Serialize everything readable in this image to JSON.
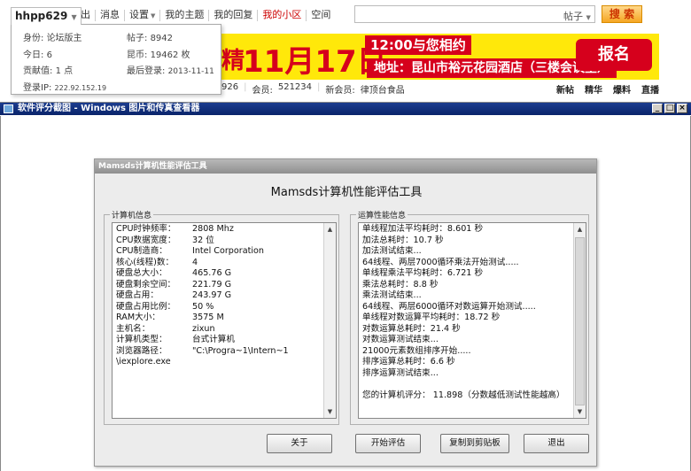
{
  "topbar": {
    "username": "hhpp629",
    "nav": [
      "退出",
      "消息",
      "设置",
      "我的主题",
      "我的回复",
      "我的小区",
      "空间"
    ],
    "search_scope": "帖子",
    "search_button": "搜 索"
  },
  "user_dropdown": {
    "identity_label": "身份:",
    "identity_value": "论坛版主",
    "posts_label": "帖子:",
    "posts_value": "8942",
    "today_label": "今日:",
    "today_value": "6",
    "coins_label": "昆币:",
    "coins_value": "19462 枚",
    "contrib_label": "贡献值:",
    "contrib_value": "1 点",
    "lastlogin_label": "最后登录:",
    "lastlogin_value": "2013-11-11",
    "ip_label": "登录IP:",
    "ip_value": "222.92.152.19"
  },
  "banner": {
    "pre": "精",
    "date": "11月17日",
    "time": "12:00与您相约",
    "address": "地址：昆山市裕元花园酒店（三楼会议室）",
    "register": "报名"
  },
  "stats": {
    "topics_tail": "926",
    "members_label": "会员:",
    "members_value": "521234",
    "newest_label": "新会员:",
    "newest_value": "律顶台食品"
  },
  "quick_links": [
    "新帖",
    "精华",
    "爆料",
    "直播"
  ],
  "viewer": {
    "title": "软件评分截图 - Windows 图片和传真查看器",
    "btn_min": "_",
    "btn_max": "□",
    "btn_close": "×"
  },
  "app": {
    "window_title": "Mamsds计算机性能评估工具",
    "heading": "Mamsds计算机性能评估工具",
    "computer_info_label": "计算机信息",
    "computer_info": [
      {
        "k": "CPU时钟频率：",
        "v": "2808 Mhz"
      },
      {
        "k": "CPU数据宽度：",
        "v": "32 位"
      },
      {
        "k": "CPU制造商：",
        "v": "Intel Corporation"
      },
      {
        "k": "核心(线程)数：",
        "v": "4"
      },
      {
        "k": "硬盘总大小：",
        "v": "465.76 G"
      },
      {
        "k": "硬盘剩余空间：",
        "v": "221.79 G"
      },
      {
        "k": "硬盘占用：",
        "v": "243.97 G"
      },
      {
        "k": "硬盘占用比例：",
        "v": "50 %"
      },
      {
        "k": "RAM大小：",
        "v": "3575 M"
      },
      {
        "k": "主机名：",
        "v": "zixun"
      },
      {
        "k": "计算机类型：",
        "v": "台式计算机"
      },
      {
        "k": "浏览器路径：",
        "v": "\"C:\\Progra~1\\Intern~1"
      },
      {
        "k": "\\iexplore.exe",
        "v": ""
      }
    ],
    "perf_info_label": "运算性能信息",
    "perf_info": [
      "单线程加法平均耗时：8.601 秒",
      "加法总耗时：10.7 秒",
      "加法测试结束...",
      "64线程、两层7000循环乘法开始测试.....",
      "单线程乘法平均耗时：6.721 秒",
      "乘法总耗时：8.8 秒",
      "乘法测试结束...",
      "64线程、两层6000循环对数运算开始测试.....",
      "单线程对数运算平均耗时：18.72 秒",
      "对数运算总耗时：21.4 秒",
      "对数运算测试结束...",
      "21000元素数组排序开始.....",
      "排序运算总耗时：6.6 秒",
      "排序运算测试结束...",
      "",
      "您的计算机评分： 11.898（分数越低测试性能越高）"
    ],
    "buttons": {
      "about": "关于",
      "start": "开始评估",
      "copy": "复制到剪贴板",
      "exit": "退出"
    }
  }
}
